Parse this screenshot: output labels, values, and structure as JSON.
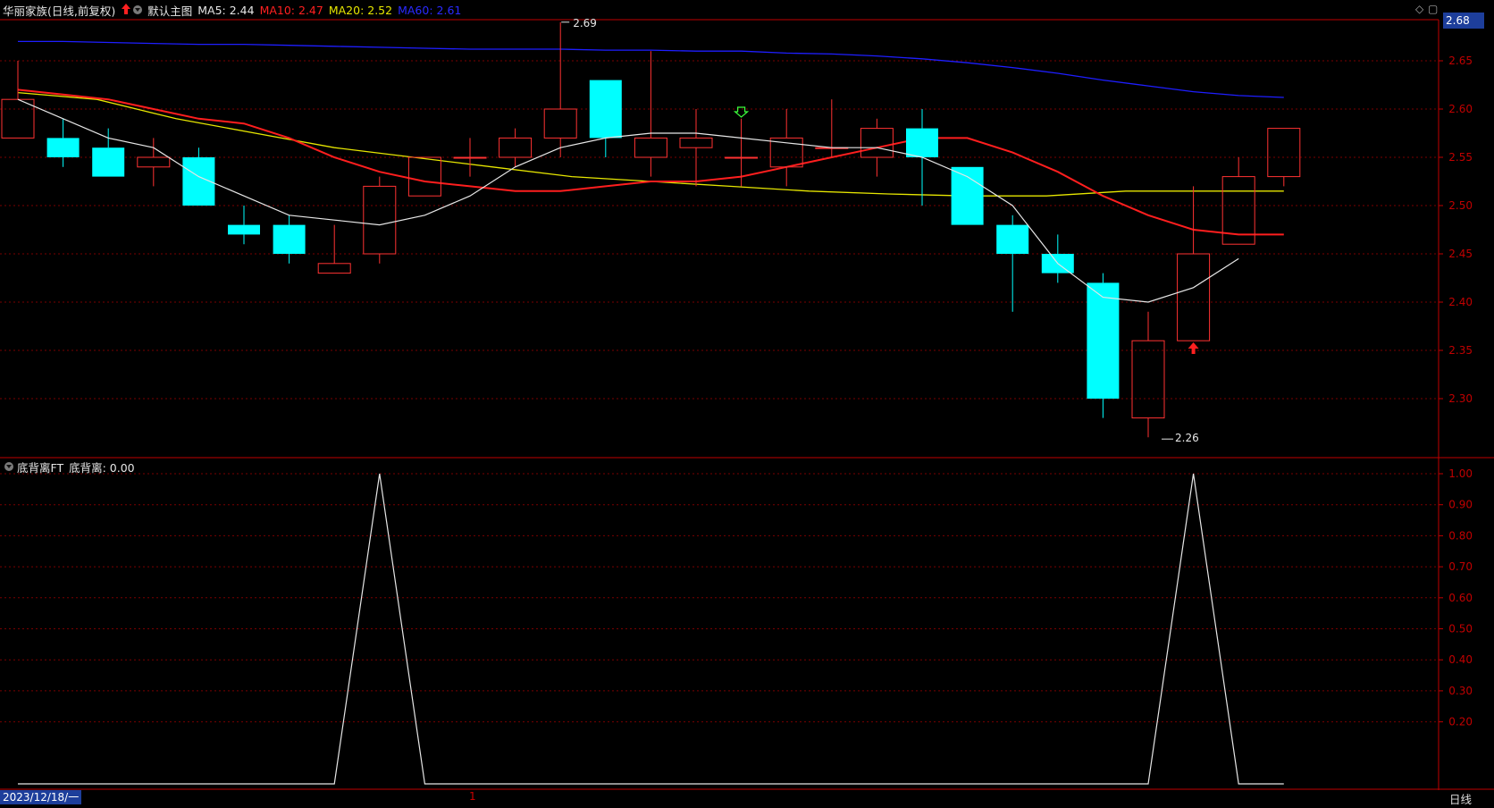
{
  "header": {
    "stock_title": "华丽家族(日线,前复权)",
    "main_chart_label": "默认主图",
    "ma5": "MA5: 2.44",
    "ma10": "MA10: 2.47",
    "ma20": "MA20: 2.52",
    "ma60": "MA60: 2.61"
  },
  "indicator_header": {
    "name": "底背离FT",
    "value": "底背离: 0.00"
  },
  "current_price_tag": "2.68",
  "date_tag": "2023/12/18/一",
  "cursor_marker": "1",
  "period_label": "日线",
  "annotations": {
    "high": "2.69",
    "low": "2.26"
  },
  "colors": {
    "up": "#ff3232",
    "down": "#00ffff",
    "ma5": "#e6e6e6",
    "ma10": "#ff1e1e",
    "ma20": "#e6e600",
    "ma60": "#1e1eff",
    "grid": "#7a0000",
    "axis": "#c00000"
  },
  "chart_data": [
    {
      "type": "candlestick",
      "y_ticks": [
        "2.65",
        "2.60",
        "2.55",
        "2.50",
        "2.45",
        "2.40",
        "2.35",
        "2.30"
      ],
      "ylim": [
        2.22,
        2.68
      ],
      "candles": [
        {
          "o": 2.57,
          "h": 2.65,
          "l": 2.57,
          "c": 2.61
        },
        {
          "o": 2.57,
          "h": 2.59,
          "l": 2.54,
          "c": 2.55
        },
        {
          "o": 2.56,
          "h": 2.58,
          "l": 2.53,
          "c": 2.53
        },
        {
          "o": 2.54,
          "h": 2.57,
          "l": 2.52,
          "c": 2.55
        },
        {
          "o": 2.55,
          "h": 2.56,
          "l": 2.5,
          "c": 2.5
        },
        {
          "o": 2.48,
          "h": 2.5,
          "l": 2.46,
          "c": 2.47
        },
        {
          "o": 2.48,
          "h": 2.49,
          "l": 2.44,
          "c": 2.45
        },
        {
          "o": 2.43,
          "h": 2.48,
          "l": 2.43,
          "c": 2.44
        },
        {
          "o": 2.45,
          "h": 2.53,
          "l": 2.44,
          "c": 2.52
        },
        {
          "o": 2.51,
          "h": 2.55,
          "l": 2.51,
          "c": 2.55
        },
        {
          "o": 2.55,
          "h": 2.57,
          "l": 2.53,
          "c": 2.55
        },
        {
          "o": 2.55,
          "h": 2.58,
          "l": 2.54,
          "c": 2.57
        },
        {
          "o": 2.57,
          "h": 2.69,
          "l": 2.55,
          "c": 2.6
        },
        {
          "o": 2.63,
          "h": 2.63,
          "l": 2.55,
          "c": 2.57
        },
        {
          "o": 2.55,
          "h": 2.66,
          "l": 2.53,
          "c": 2.57
        },
        {
          "o": 2.56,
          "h": 2.6,
          "l": 2.52,
          "c": 2.57
        },
        {
          "o": 2.55,
          "h": 2.59,
          "l": 2.52,
          "c": 2.55
        },
        {
          "o": 2.54,
          "h": 2.6,
          "l": 2.52,
          "c": 2.57
        },
        {
          "o": 2.56,
          "h": 2.61,
          "l": 2.55,
          "c": 2.56
        },
        {
          "o": 2.55,
          "h": 2.59,
          "l": 2.53,
          "c": 2.58
        },
        {
          "o": 2.58,
          "h": 2.6,
          "l": 2.5,
          "c": 2.55
        },
        {
          "o": 2.54,
          "h": 2.54,
          "l": 2.48,
          "c": 2.48
        },
        {
          "o": 2.48,
          "h": 2.49,
          "l": 2.39,
          "c": 2.45
        },
        {
          "o": 2.45,
          "h": 2.47,
          "l": 2.42,
          "c": 2.43
        },
        {
          "o": 2.42,
          "h": 2.43,
          "l": 2.28,
          "c": 2.3
        },
        {
          "o": 2.28,
          "h": 2.39,
          "l": 2.26,
          "c": 2.36
        },
        {
          "o": 2.36,
          "h": 2.52,
          "l": 2.36,
          "c": 2.45
        },
        {
          "o": 2.46,
          "h": 2.55,
          "l": 2.46,
          "c": 2.53
        },
        {
          "o": 2.53,
          "h": 2.58,
          "l": 2.52,
          "c": 2.58
        }
      ],
      "series": [
        {
          "values": [
            2.61,
            2.59,
            2.57,
            2.56,
            2.53,
            2.51,
            2.49,
            2.485,
            2.48,
            2.49,
            2.51,
            2.54,
            2.56,
            2.57,
            2.575,
            2.575,
            2.57,
            2.565,
            2.56,
            2.56,
            2.55,
            2.53,
            2.5,
            2.44,
            2.405,
            2.4,
            2.415,
            2.445
          ]
        },
        {
          "values": [
            2.62,
            2.615,
            2.61,
            2.6,
            2.59,
            2.585,
            2.57,
            2.55,
            2.535,
            2.525,
            2.52,
            2.515,
            2.515,
            2.52,
            2.525,
            2.525,
            2.53,
            2.54,
            2.55,
            2.56,
            2.57,
            2.57,
            2.555,
            2.535,
            2.51,
            2.49,
            2.475,
            2.47,
            2.47
          ]
        },
        {
          "values": [
            2.617,
            2.61,
            2.59,
            2.575,
            2.56,
            2.55,
            2.54,
            2.53,
            2.525,
            2.52,
            2.515,
            2.512,
            2.51,
            2.51,
            2.515,
            2.515,
            2.515
          ]
        },
        {
          "values": [
            2.67,
            2.67,
            2.669,
            2.668,
            2.667,
            2.667,
            2.666,
            2.665,
            2.664,
            2.663,
            2.662,
            2.662,
            2.662,
            2.661,
            2.661,
            2.66,
            2.66,
            2.658,
            2.657,
            2.655,
            2.652,
            2.648,
            2.643,
            2.637,
            2.63,
            2.624,
            2.618,
            2.614,
            2.612
          ]
        }
      ]
    },
    {
      "type": "line",
      "y_ticks": [
        "1.00",
        "0.90",
        "0.80",
        "0.70",
        "0.60",
        "0.50",
        "0.40",
        "0.30",
        "0.20"
      ],
      "ylim": [
        0,
        1
      ],
      "values": [
        0,
        0,
        0,
        0,
        0,
        0,
        0,
        0,
        1,
        0,
        0,
        0,
        0,
        0,
        0,
        0,
        0,
        0,
        0,
        0,
        0,
        0,
        0,
        0,
        0,
        0,
        1,
        0,
        0
      ]
    }
  ]
}
